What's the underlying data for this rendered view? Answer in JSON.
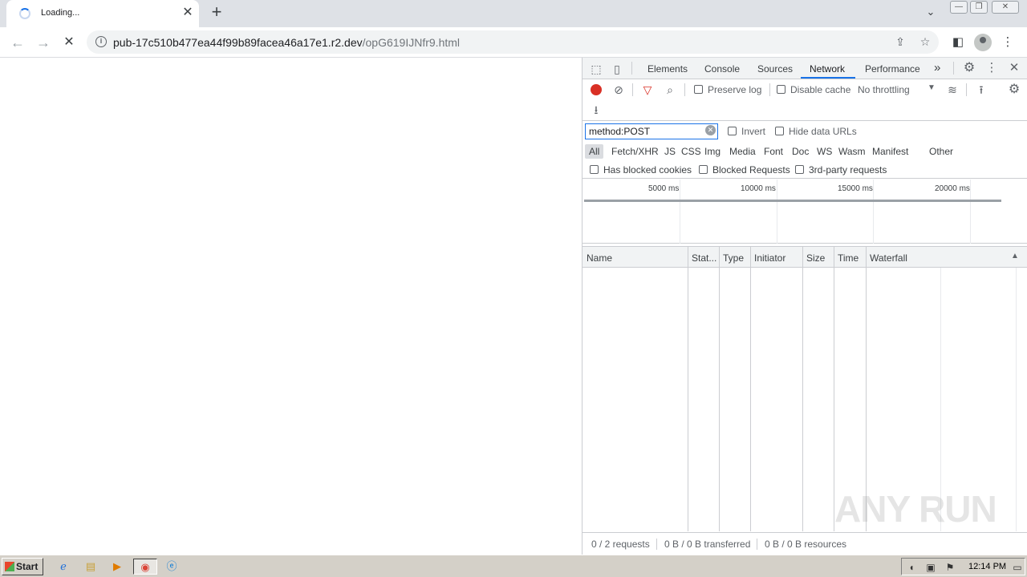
{
  "tab": {
    "title": "Loading...",
    "close": "✕",
    "new_tab": "+"
  },
  "window": {
    "tab_search": "⌄",
    "minimize": "—",
    "restore": "❐",
    "close": "✕"
  },
  "toolbar": {
    "back": "←",
    "forward": "→",
    "reload": "✕",
    "url_host": "pub-17c510b477ea44f99b89facea46a17e1.r2.dev",
    "url_path": "/opG619IJNfr9.html"
  },
  "devtools": {
    "tabs": [
      "Elements",
      "Console",
      "Sources",
      "Network",
      "Performance"
    ],
    "active_tab": "Network",
    "more_tabs": "»",
    "network_toolbar": {
      "preserve_log": "Preserve log",
      "disable_cache": "Disable cache",
      "throttling": "No throttling"
    },
    "filter": {
      "value": "method:POST",
      "invert": "Invert",
      "hide_data_urls": "Hide data URLs",
      "types": [
        "All",
        "Fetch/XHR",
        "JS",
        "CSS",
        "Img",
        "Media",
        "Font",
        "Doc",
        "WS",
        "Wasm",
        "Manifest",
        "Other"
      ],
      "active_type": "All",
      "has_blocked_cookies": "Has blocked cookies",
      "blocked_requests": "Blocked Requests",
      "third_party": "3rd-party requests"
    },
    "overview_ticks": [
      "5000 ms",
      "10000 ms",
      "15000 ms",
      "20000 ms"
    ],
    "columns": [
      "Name",
      "Stat...",
      "Type",
      "Initiator",
      "Size",
      "Time",
      "Waterfall"
    ],
    "status": {
      "requests": "0 / 2 requests",
      "transferred": "0 B / 0 B transferred",
      "resources": "0 B / 0 B resources"
    }
  },
  "watermark": "ANY RUN",
  "taskbar": {
    "start": "Start",
    "clock": "12:14 PM"
  },
  "colors": {
    "record": "#d93025",
    "accent": "#1a73e8"
  }
}
